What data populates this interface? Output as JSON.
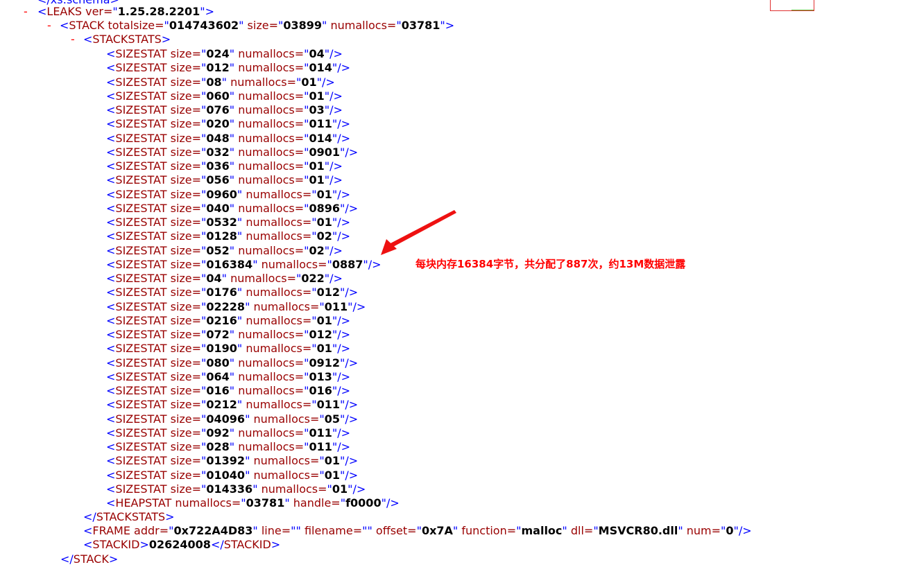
{
  "top_cut_line": "</xs:schema>",
  "leaks": {
    "tag": "LEAKS",
    "attr": "ver",
    "value": "1.25.28.2201"
  },
  "stack": {
    "tag": "STACK",
    "totalsize": "014743602",
    "size": "03899",
    "numallocs": "03781"
  },
  "stackstats_tag": "STACKSTATS",
  "sizestats": [
    {
      "size": "024",
      "numallocs": "04"
    },
    {
      "size": "012",
      "numallocs": "014"
    },
    {
      "size": "08",
      "numallocs": "01"
    },
    {
      "size": "060",
      "numallocs": "01"
    },
    {
      "size": "076",
      "numallocs": "03"
    },
    {
      "size": "020",
      "numallocs": "011"
    },
    {
      "size": "048",
      "numallocs": "014"
    },
    {
      "size": "032",
      "numallocs": "0901"
    },
    {
      "size": "036",
      "numallocs": "01"
    },
    {
      "size": "056",
      "numallocs": "01"
    },
    {
      "size": "0960",
      "numallocs": "01"
    },
    {
      "size": "040",
      "numallocs": "0896"
    },
    {
      "size": "0532",
      "numallocs": "01"
    },
    {
      "size": "0128",
      "numallocs": "02"
    },
    {
      "size": "052",
      "numallocs": "02"
    },
    {
      "size": "016384",
      "numallocs": "0887"
    },
    {
      "size": "04",
      "numallocs": "022"
    },
    {
      "size": "0176",
      "numallocs": "012"
    },
    {
      "size": "02228",
      "numallocs": "011"
    },
    {
      "size": "0216",
      "numallocs": "01"
    },
    {
      "size": "072",
      "numallocs": "012"
    },
    {
      "size": "0190",
      "numallocs": "01"
    },
    {
      "size": "080",
      "numallocs": "0912"
    },
    {
      "size": "064",
      "numallocs": "013"
    },
    {
      "size": "016",
      "numallocs": "016"
    },
    {
      "size": "0212",
      "numallocs": "011"
    },
    {
      "size": "04096",
      "numallocs": "05"
    },
    {
      "size": "092",
      "numallocs": "011"
    },
    {
      "size": "028",
      "numallocs": "011"
    },
    {
      "size": "01392",
      "numallocs": "01"
    },
    {
      "size": "01040",
      "numallocs": "01"
    },
    {
      "size": "014336",
      "numallocs": "01"
    }
  ],
  "heapstat": {
    "numallocs": "03781",
    "handle": "f0000"
  },
  "frame": {
    "addr": "0x722A4D83",
    "line": "",
    "filename": "",
    "offset": "0x7A",
    "function": "malloc",
    "dll": "MSVCR80.dll",
    "num": "0"
  },
  "stackid": "02624008",
  "annotation_text": "每块内存16384字节，共分配了887次，约13M数据泄露",
  "colors": {
    "bracket": "#0000ff",
    "tag": "#990000",
    "value": "#000000",
    "toggle": "#ff0000",
    "annotation": "#ff0000"
  }
}
